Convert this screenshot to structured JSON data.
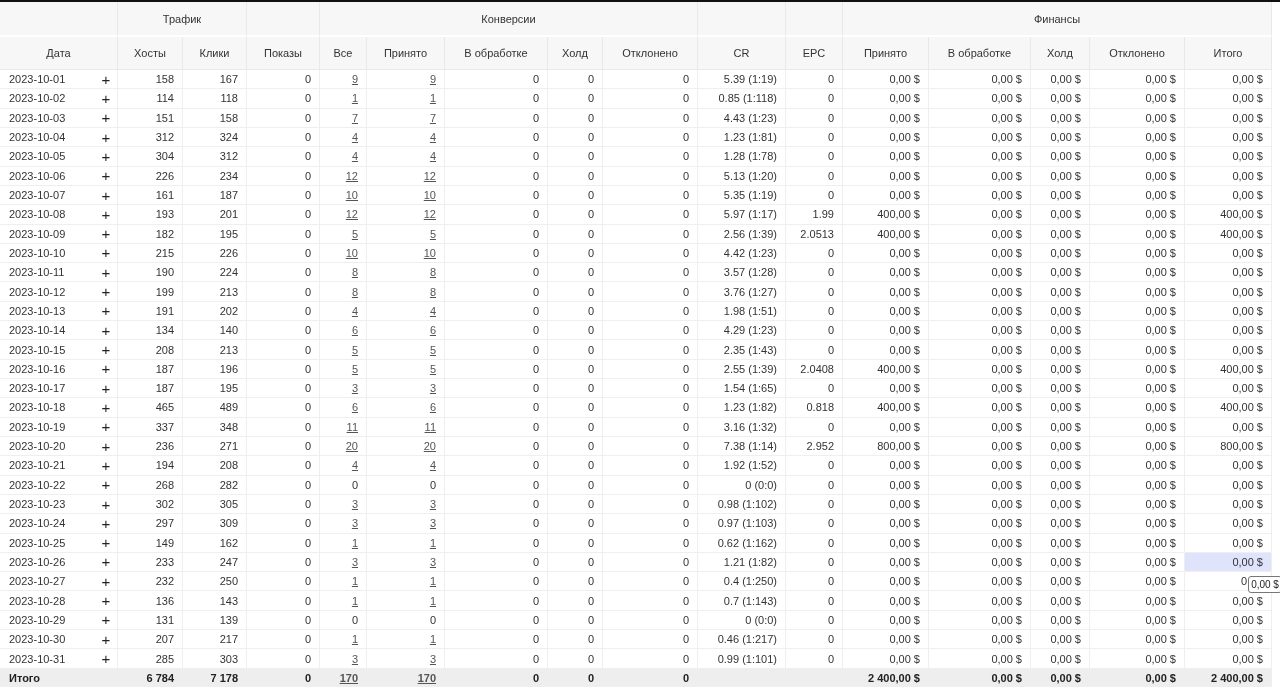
{
  "groups": [
    {
      "columns": [
        "Дата"
      ]
    },
    {
      "label": "Трафик",
      "columns": [
        "Хосты",
        "Клики"
      ]
    },
    {
      "columns": [
        "Показы"
      ]
    },
    {
      "label": "Конверсии",
      "columns": [
        "Все",
        "Принято",
        "В обработке",
        "Холд",
        "Отклонено"
      ]
    },
    {
      "columns": [
        "CR"
      ]
    },
    {
      "columns": [
        "EPC"
      ]
    },
    {
      "label": "Финансы",
      "columns": [
        "Принято",
        "В обработке",
        "Холд",
        "Отклонено",
        "Итого"
      ]
    }
  ],
  "rows": [
    {
      "date": "2023-10-01",
      "expand": "+",
      "linked": true,
      "selected": false,
      "cells": [
        "158",
        "167",
        "0",
        "9",
        "9",
        "0",
        "0",
        "0",
        "5.39 (1:19)",
        "0",
        "0,00 $",
        "0,00 $",
        "0,00 $",
        "0,00 $",
        "0,00 $"
      ]
    },
    {
      "date": "2023-10-02",
      "expand": "+",
      "linked": true,
      "selected": false,
      "cells": [
        "114",
        "118",
        "0",
        "1",
        "1",
        "0",
        "0",
        "0",
        "0.85 (1:118)",
        "0",
        "0,00 $",
        "0,00 $",
        "0,00 $",
        "0,00 $",
        "0,00 $"
      ]
    },
    {
      "date": "2023-10-03",
      "expand": "+",
      "linked": true,
      "selected": false,
      "cells": [
        "151",
        "158",
        "0",
        "7",
        "7",
        "0",
        "0",
        "0",
        "4.43 (1:23)",
        "0",
        "0,00 $",
        "0,00 $",
        "0,00 $",
        "0,00 $",
        "0,00 $"
      ]
    },
    {
      "date": "2023-10-04",
      "expand": "+",
      "linked": true,
      "selected": false,
      "cells": [
        "312",
        "324",
        "0",
        "4",
        "4",
        "0",
        "0",
        "0",
        "1.23 (1:81)",
        "0",
        "0,00 $",
        "0,00 $",
        "0,00 $",
        "0,00 $",
        "0,00 $"
      ]
    },
    {
      "date": "2023-10-05",
      "expand": "+",
      "linked": true,
      "selected": false,
      "cells": [
        "304",
        "312",
        "0",
        "4",
        "4",
        "0",
        "0",
        "0",
        "1.28 (1:78)",
        "0",
        "0,00 $",
        "0,00 $",
        "0,00 $",
        "0,00 $",
        "0,00 $"
      ]
    },
    {
      "date": "2023-10-06",
      "expand": "+",
      "linked": true,
      "selected": false,
      "cells": [
        "226",
        "234",
        "0",
        "12",
        "12",
        "0",
        "0",
        "0",
        "5.13 (1:20)",
        "0",
        "0,00 $",
        "0,00 $",
        "0,00 $",
        "0,00 $",
        "0,00 $"
      ]
    },
    {
      "date": "2023-10-07",
      "expand": "+",
      "linked": true,
      "selected": false,
      "cells": [
        "161",
        "187",
        "0",
        "10",
        "10",
        "0",
        "0",
        "0",
        "5.35 (1:19)",
        "0",
        "0,00 $",
        "0,00 $",
        "0,00 $",
        "0,00 $",
        "0,00 $"
      ]
    },
    {
      "date": "2023-10-08",
      "expand": "+",
      "linked": true,
      "selected": false,
      "cells": [
        "193",
        "201",
        "0",
        "12",
        "12",
        "0",
        "0",
        "0",
        "5.97 (1:17)",
        "1.99",
        "400,00 $",
        "0,00 $",
        "0,00 $",
        "0,00 $",
        "400,00 $"
      ]
    },
    {
      "date": "2023-10-09",
      "expand": "+",
      "linked": true,
      "selected": false,
      "cells": [
        "182",
        "195",
        "0",
        "5",
        "5",
        "0",
        "0",
        "0",
        "2.56 (1:39)",
        "2.0513",
        "400,00 $",
        "0,00 $",
        "0,00 $",
        "0,00 $",
        "400,00 $"
      ]
    },
    {
      "date": "2023-10-10",
      "expand": "+",
      "linked": true,
      "selected": false,
      "cells": [
        "215",
        "226",
        "0",
        "10",
        "10",
        "0",
        "0",
        "0",
        "4.42 (1:23)",
        "0",
        "0,00 $",
        "0,00 $",
        "0,00 $",
        "0,00 $",
        "0,00 $"
      ]
    },
    {
      "date": "2023-10-11",
      "expand": "+",
      "linked": true,
      "selected": false,
      "cells": [
        "190",
        "224",
        "0",
        "8",
        "8",
        "0",
        "0",
        "0",
        "3.57 (1:28)",
        "0",
        "0,00 $",
        "0,00 $",
        "0,00 $",
        "0,00 $",
        "0,00 $"
      ]
    },
    {
      "date": "2023-10-12",
      "expand": "+",
      "linked": true,
      "selected": false,
      "cells": [
        "199",
        "213",
        "0",
        "8",
        "8",
        "0",
        "0",
        "0",
        "3.76 (1:27)",
        "0",
        "0,00 $",
        "0,00 $",
        "0,00 $",
        "0,00 $",
        "0,00 $"
      ]
    },
    {
      "date": "2023-10-13",
      "expand": "+",
      "linked": true,
      "selected": false,
      "cells": [
        "191",
        "202",
        "0",
        "4",
        "4",
        "0",
        "0",
        "0",
        "1.98 (1:51)",
        "0",
        "0,00 $",
        "0,00 $",
        "0,00 $",
        "0,00 $",
        "0,00 $"
      ]
    },
    {
      "date": "2023-10-14",
      "expand": "+",
      "linked": true,
      "selected": false,
      "cells": [
        "134",
        "140",
        "0",
        "6",
        "6",
        "0",
        "0",
        "0",
        "4.29 (1:23)",
        "0",
        "0,00 $",
        "0,00 $",
        "0,00 $",
        "0,00 $",
        "0,00 $"
      ]
    },
    {
      "date": "2023-10-15",
      "expand": "+",
      "linked": true,
      "selected": false,
      "cells": [
        "208",
        "213",
        "0",
        "5",
        "5",
        "0",
        "0",
        "0",
        "2.35 (1:43)",
        "0",
        "0,00 $",
        "0,00 $",
        "0,00 $",
        "0,00 $",
        "0,00 $"
      ]
    },
    {
      "date": "2023-10-16",
      "expand": "+",
      "linked": true,
      "selected": false,
      "cells": [
        "187",
        "196",
        "0",
        "5",
        "5",
        "0",
        "0",
        "0",
        "2.55 (1:39)",
        "2.0408",
        "400,00 $",
        "0,00 $",
        "0,00 $",
        "0,00 $",
        "400,00 $"
      ]
    },
    {
      "date": "2023-10-17",
      "expand": "+",
      "linked": true,
      "selected": false,
      "cells": [
        "187",
        "195",
        "0",
        "3",
        "3",
        "0",
        "0",
        "0",
        "1.54 (1:65)",
        "0",
        "0,00 $",
        "0,00 $",
        "0,00 $",
        "0,00 $",
        "0,00 $"
      ]
    },
    {
      "date": "2023-10-18",
      "expand": "+",
      "linked": true,
      "selected": false,
      "cells": [
        "465",
        "489",
        "0",
        "6",
        "6",
        "0",
        "0",
        "0",
        "1.23 (1:82)",
        "0.818",
        "400,00 $",
        "0,00 $",
        "0,00 $",
        "0,00 $",
        "400,00 $"
      ]
    },
    {
      "date": "2023-10-19",
      "expand": "+",
      "linked": true,
      "selected": false,
      "cells": [
        "337",
        "348",
        "0",
        "11",
        "11",
        "0",
        "0",
        "0",
        "3.16 (1:32)",
        "0",
        "0,00 $",
        "0,00 $",
        "0,00 $",
        "0,00 $",
        "0,00 $"
      ]
    },
    {
      "date": "2023-10-20",
      "expand": "+",
      "linked": true,
      "selected": false,
      "cells": [
        "236",
        "271",
        "0",
        "20",
        "20",
        "0",
        "0",
        "0",
        "7.38 (1:14)",
        "2.952",
        "800,00 $",
        "0,00 $",
        "0,00 $",
        "0,00 $",
        "800,00 $"
      ]
    },
    {
      "date": "2023-10-21",
      "expand": "+",
      "linked": true,
      "selected": false,
      "cells": [
        "194",
        "208",
        "0",
        "4",
        "4",
        "0",
        "0",
        "0",
        "1.92 (1:52)",
        "0",
        "0,00 $",
        "0,00 $",
        "0,00 $",
        "0,00 $",
        "0,00 $"
      ]
    },
    {
      "date": "2023-10-22",
      "expand": "+",
      "linked": false,
      "selected": false,
      "cells": [
        "268",
        "282",
        "0",
        "0",
        "0",
        "0",
        "0",
        "0",
        "0 (0:0)",
        "0",
        "0,00 $",
        "0,00 $",
        "0,00 $",
        "0,00 $",
        "0,00 $"
      ]
    },
    {
      "date": "2023-10-23",
      "expand": "+",
      "linked": true,
      "selected": false,
      "cells": [
        "302",
        "305",
        "0",
        "3",
        "3",
        "0",
        "0",
        "0",
        "0.98 (1:102)",
        "0",
        "0,00 $",
        "0,00 $",
        "0,00 $",
        "0,00 $",
        "0,00 $"
      ]
    },
    {
      "date": "2023-10-24",
      "expand": "+",
      "linked": true,
      "selected": false,
      "cells": [
        "297",
        "309",
        "0",
        "3",
        "3",
        "0",
        "0",
        "0",
        "0.97 (1:103)",
        "0",
        "0,00 $",
        "0,00 $",
        "0,00 $",
        "0,00 $",
        "0,00 $"
      ]
    },
    {
      "date": "2023-10-25",
      "expand": "+",
      "linked": true,
      "selected": false,
      "cells": [
        "149",
        "162",
        "0",
        "1",
        "1",
        "0",
        "0",
        "0",
        "0.62 (1:162)",
        "0",
        "0,00 $",
        "0,00 $",
        "0,00 $",
        "0,00 $",
        "0,00 $"
      ]
    },
    {
      "date": "2023-10-26",
      "expand": "+",
      "linked": true,
      "selected": true,
      "cells": [
        "233",
        "247",
        "0",
        "3",
        "3",
        "0",
        "0",
        "0",
        "1.21 (1:82)",
        "0",
        "0,00 $",
        "0,00 $",
        "0,00 $",
        "0,00 $",
        "0,00 $"
      ]
    },
    {
      "date": "2023-10-27",
      "expand": "+",
      "linked": true,
      "selected": false,
      "tooltip": "0,00 $",
      "cells": [
        "232",
        "250",
        "0",
        "1",
        "1",
        "0",
        "0",
        "0",
        "0.4 (1:250)",
        "0",
        "0,00 $",
        "0,00 $",
        "0,00 $",
        "0,00 $",
        "0"
      ]
    },
    {
      "date": "2023-10-28",
      "expand": "+",
      "linked": true,
      "selected": false,
      "cells": [
        "136",
        "143",
        "0",
        "1",
        "1",
        "0",
        "0",
        "0",
        "0.7 (1:143)",
        "0",
        "0,00 $",
        "0,00 $",
        "0,00 $",
        "0,00 $",
        "0,00 $"
      ]
    },
    {
      "date": "2023-10-29",
      "expand": "+",
      "linked": false,
      "selected": false,
      "cells": [
        "131",
        "139",
        "0",
        "0",
        "0",
        "0",
        "0",
        "0",
        "0 (0:0)",
        "0",
        "0,00 $",
        "0,00 $",
        "0,00 $",
        "0,00 $",
        "0,00 $"
      ]
    },
    {
      "date": "2023-10-30",
      "expand": "+",
      "linked": true,
      "selected": false,
      "cells": [
        "207",
        "217",
        "0",
        "1",
        "1",
        "0",
        "0",
        "0",
        "0.46 (1:217)",
        "0",
        "0,00 $",
        "0,00 $",
        "0,00 $",
        "0,00 $",
        "0,00 $"
      ]
    },
    {
      "date": "2023-10-31",
      "expand": "+",
      "linked": true,
      "selected": false,
      "cells": [
        "285",
        "303",
        "0",
        "3",
        "3",
        "0",
        "0",
        "0",
        "0.99 (1:101)",
        "0",
        "0,00 $",
        "0,00 $",
        "0,00 $",
        "0,00 $",
        "0,00 $"
      ]
    }
  ],
  "totals": {
    "label": "Итого",
    "linked": true,
    "cells": [
      "6 784",
      "7 178",
      "0",
      "170",
      "170",
      "0",
      "0",
      "0",
      null,
      null,
      "2 400,00 $",
      "0,00 $",
      "0,00 $",
      "0,00 $",
      "2 400,00 $"
    ]
  }
}
